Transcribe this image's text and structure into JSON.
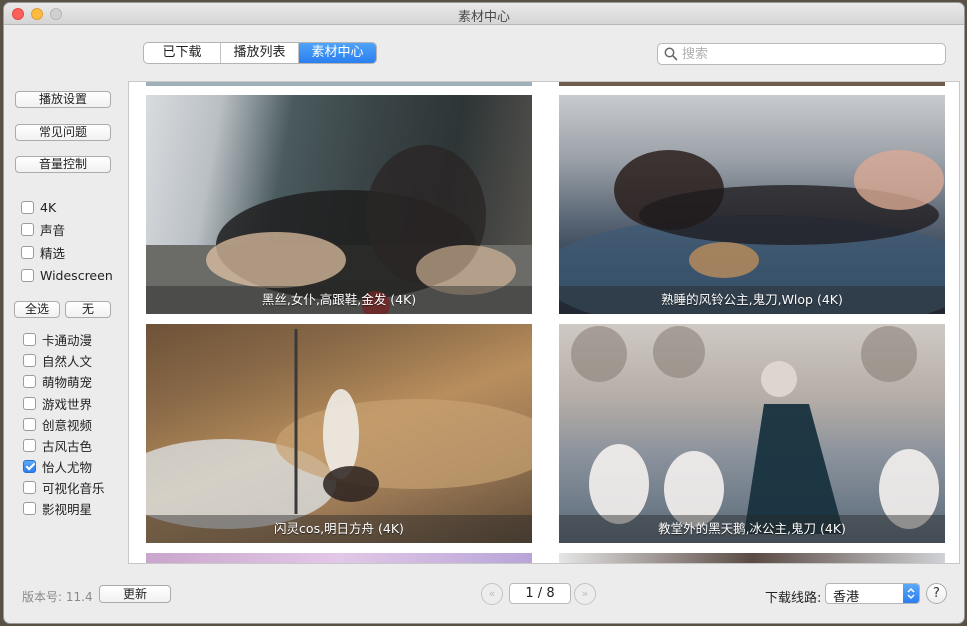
{
  "window": {
    "title": "素材中心"
  },
  "tabs": [
    {
      "label": "已下载"
    },
    {
      "label": "播放列表"
    },
    {
      "label": "素材中心"
    }
  ],
  "search": {
    "placeholder": "搜索"
  },
  "sidebar": {
    "buttons": {
      "playback": "播放设置",
      "faq": "常见问题",
      "volume": "音量控制"
    },
    "filters": [
      {
        "label": "4K",
        "checked": false
      },
      {
        "label": "声音",
        "checked": false
      },
      {
        "label": "精选",
        "checked": false
      },
      {
        "label": "Widescreen",
        "checked": false
      }
    ],
    "select_all": "全选",
    "select_none": "无",
    "categories": [
      {
        "label": "卡通动漫",
        "checked": false
      },
      {
        "label": "自然人文",
        "checked": false
      },
      {
        "label": "萌物萌宠",
        "checked": false
      },
      {
        "label": "游戏世界",
        "checked": false
      },
      {
        "label": "创意视频",
        "checked": false
      },
      {
        "label": "古风古色",
        "checked": false
      },
      {
        "label": "怡人尤物",
        "checked": true
      },
      {
        "label": "可视化音乐",
        "checked": false
      },
      {
        "label": "影视明星",
        "checked": false
      }
    ]
  },
  "gallery": {
    "items": [
      {
        "caption": "黑丝,女仆,高跟鞋,金发 (4K)"
      },
      {
        "caption": "熟睡的风铃公主,鬼刀,Wlop (4K)"
      },
      {
        "caption": "闪灵cos,明日方舟 (4K)"
      },
      {
        "caption": "教堂外的黑天鹅,冰公主,鬼刀 (4K)"
      }
    ]
  },
  "footer": {
    "version": "版本号: 11.4",
    "update": "更新",
    "page": "1 / 8",
    "route_label": "下载线路:",
    "route_value": "香港",
    "help": "?"
  },
  "colors": {
    "accent": "#2a7ff0",
    "checked": "#2b7ef0"
  }
}
